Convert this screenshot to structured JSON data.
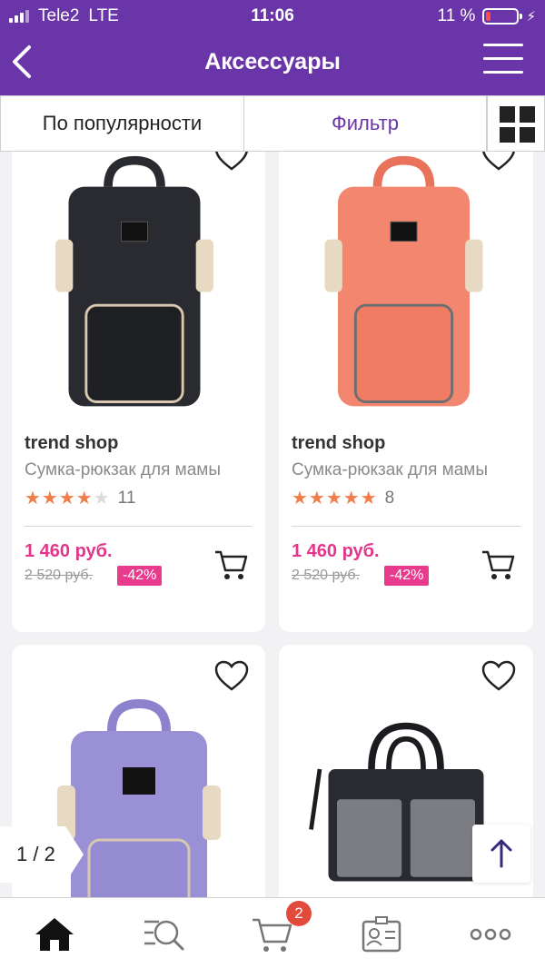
{
  "status_bar": {
    "carrier": "Tele2",
    "network": "LTE",
    "time": "11:06",
    "battery": "11 %"
  },
  "header": {
    "title": "Аксессуары"
  },
  "toolbar": {
    "sort_label": "По популярности",
    "filter_label": "Фильтр"
  },
  "products": [
    {
      "brand": "trend shop",
      "name": "Сумка-рюкзак для мамы",
      "rating": 4,
      "reviews": "11",
      "price": "1 460 руб.",
      "old_price": "2 520 руб.",
      "discount": "-42%",
      "color": "#2a2b30"
    },
    {
      "brand": "trend shop",
      "name": "Сумка-рюкзак для мамы",
      "rating": 5,
      "reviews": "8",
      "price": "1 460 руб.",
      "old_price": "2 520 руб.",
      "discount": "-42%",
      "color": "#f3866e"
    },
    {
      "color": "#9a90d6"
    },
    {
      "color": "#2a2b30"
    }
  ],
  "pager": {
    "text": "1 / 2"
  },
  "cart_badge": "2",
  "colors": {
    "brand_purple": "#6a35a8",
    "price_pink": "#e3368b",
    "star_orange": "#f07d4a",
    "badge_red": "#e24a3b"
  },
  "tabs": [
    {
      "icon": "home-icon"
    },
    {
      "icon": "search-icon"
    },
    {
      "icon": "cart-icon"
    },
    {
      "icon": "profile-card-icon"
    },
    {
      "icon": "more-icon"
    }
  ]
}
